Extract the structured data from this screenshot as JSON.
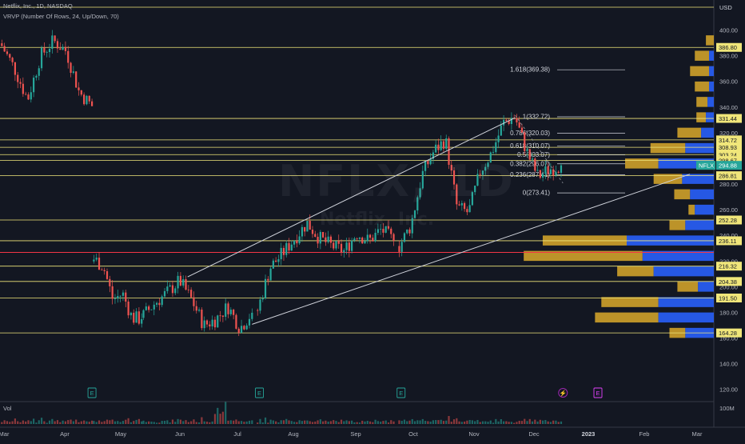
{
  "header": {
    "symbol_line": "Netflix, Inc., 1D, NASDAQ",
    "indicator_line": "VRVP (Number Of Rows, 24, Up/Down, 70)",
    "watermark_symbol": "NFLX, 1D",
    "watermark_name": "Netflix, Inc."
  },
  "currency_label": "USD",
  "volume_label": "Vol",
  "colors": {
    "background": "#131722",
    "up": "#26a69a",
    "down": "#ef5350",
    "level_line": "#f0e67a",
    "red_line": "#f23645",
    "vp_up": "#2962ff",
    "vp_down": "#d4a52a"
  },
  "chart_data": {
    "type": "candlestick",
    "title": "Netflix, Inc., 1D, NASDAQ",
    "y_axis": {
      "ticks": [
        120,
        140,
        160,
        180,
        200,
        220,
        240,
        260,
        280,
        300,
        320,
        340,
        360,
        380,
        400
      ],
      "ylim": [
        112,
        420
      ],
      "scale": "linear",
      "currency": "USD"
    },
    "x_axis": {
      "ticks": [
        "Mar",
        "Apr",
        "May",
        "Jun",
        "Jul",
        "Aug",
        "Sep",
        "Oct",
        "Nov",
        "Dec",
        "2023",
        "Feb",
        "Mar"
      ],
      "bold_tick": "2023"
    },
    "price_segments": [
      {
        "from_date": "2022-03-01",
        "to_date": "2022-04-19",
        "start": 390,
        "end": 341,
        "waypoints": [
          388,
          370,
          346,
          380,
          392,
          384,
          352,
          341
        ]
      },
      {
        "from_date": "2022-04-20",
        "to_date": "2022-05-16",
        "start": 220,
        "end": 175,
        "waypoints": [
          222,
          216,
          190,
          195,
          176,
          175
        ]
      },
      {
        "from_date": "2022-05-17",
        "to_date": "2022-07-15",
        "start": 176,
        "end": 180,
        "waypoints": [
          178,
          188,
          196,
          205,
          190,
          170,
          175,
          185,
          168,
          180
        ]
      },
      {
        "from_date": "2022-07-18",
        "to_date": "2022-09-30",
        "start": 182,
        "end": 236,
        "waypoints": [
          182,
          215,
          226,
          238,
          250,
          238,
          232,
          228,
          242,
          236,
          245,
          236
        ]
      },
      {
        "from_date": "2022-10-03",
        "to_date": "2022-12-30",
        "start": 232,
        "end": 294.88,
        "waypoints": [
          232,
          248,
          288,
          306,
          315,
          262,
          258,
          290,
          305,
          328,
          333,
          306,
          286,
          292,
          294.88
        ]
      }
    ],
    "horizontal_levels": [
      {
        "value": 386.8,
        "label": "386.80"
      },
      {
        "value": 331.44,
        "label": "331.44"
      },
      {
        "value": 314.72,
        "label": "314.72"
      },
      {
        "value": 308.93,
        "label": "308.93"
      },
      {
        "value": 303.24,
        "label": "303.24"
      },
      {
        "value": 298.67,
        "label": "298.67"
      },
      {
        "value": 286.81,
        "label": "286.81"
      },
      {
        "value": 252.28,
        "label": "252.28"
      },
      {
        "value": 236.11,
        "label": "236.11"
      },
      {
        "value": 216.32,
        "label": "216.32"
      },
      {
        "value": 204.38,
        "label": "204.38"
      },
      {
        "value": 191.5,
        "label": "191.50"
      },
      {
        "value": 164.28,
        "label": "164.28"
      }
    ],
    "red_level": 227,
    "current_price": {
      "symbol": "NFLX",
      "value": 294.88,
      "label": "294.88"
    },
    "fibonacci": [
      {
        "ratio": 1.618,
        "value": 369.38,
        "label": "1.618(369.38)"
      },
      {
        "ratio": 1,
        "value": 332.72,
        "label": "1(332.72)"
      },
      {
        "ratio": 0.786,
        "value": 320.03,
        "label": "0.786(320.03)"
      },
      {
        "ratio": 0.618,
        "value": 310.07,
        "label": "0.618(310.07)"
      },
      {
        "ratio": 0.5,
        "value": 303.07,
        "label": "0.5(303.07)"
      },
      {
        "ratio": 0.382,
        "value": 296.07,
        "label": "0.382(296.07)"
      },
      {
        "ratio": 0.236,
        "value": 287.41,
        "label": "0.236(287.41)"
      },
      {
        "ratio": 0,
        "value": 273.41,
        "label": "0(273.41)"
      }
    ],
    "trendlines": [
      {
        "from": [
          "2022-06-10",
          208
        ],
        "to": [
          "2022-12-05",
          332
        ]
      },
      {
        "from": [
          "2022-07-15",
          171
        ],
        "to": [
          "2023-03-10",
          288
        ]
      },
      {
        "from": [
          "2022-12-05",
          334
        ],
        "to": [
          "2022-12-31",
          281
        ],
        "dashed": true
      }
    ],
    "volume_profile": [
      {
        "price": 392,
        "up": 0,
        "down": 5
      },
      {
        "price": 380,
        "up": 3,
        "down": 9
      },
      {
        "price": 368,
        "up": 3,
        "down": 12
      },
      {
        "price": 356,
        "up": 3,
        "down": 9
      },
      {
        "price": 344,
        "up": 4,
        "down": 7
      },
      {
        "price": 332,
        "up": 5,
        "down": 6
      },
      {
        "price": 320,
        "up": 8,
        "down": 15
      },
      {
        "price": 308,
        "up": 18,
        "down": 22
      },
      {
        "price": 296,
        "up": 35,
        "down": 21
      },
      {
        "price": 284,
        "up": 20,
        "down": 18
      },
      {
        "price": 272,
        "up": 15,
        "down": 10
      },
      {
        "price": 260,
        "up": 12,
        "down": 4
      },
      {
        "price": 248,
        "up": 18,
        "down": 10
      },
      {
        "price": 236,
        "up": 55,
        "down": 53
      },
      {
        "price": 224,
        "up": 45,
        "down": 75
      },
      {
        "price": 212,
        "up": 38,
        "down": 23
      },
      {
        "price": 200,
        "up": 10,
        "down": 13
      },
      {
        "price": 188,
        "up": 35,
        "down": 36
      },
      {
        "price": 176,
        "up": 35,
        "down": 40
      },
      {
        "price": 164,
        "up": 18,
        "down": 10
      }
    ],
    "event_markers": [
      {
        "date": "2022-04-19",
        "type": "earnings",
        "label": "E"
      },
      {
        "date": "2022-07-19",
        "type": "earnings",
        "label": "E"
      },
      {
        "date": "2022-10-04",
        "type": "earnings",
        "label": "E"
      },
      {
        "date": "2022-12-31",
        "type": "split",
        "label": "⚡"
      },
      {
        "date": "2023-01-19",
        "type": "earnings",
        "label": "E"
      }
    ],
    "volume": {
      "label": "Vol",
      "ticks": [
        {
          "value": 100,
          "label": "100M"
        }
      ]
    }
  }
}
